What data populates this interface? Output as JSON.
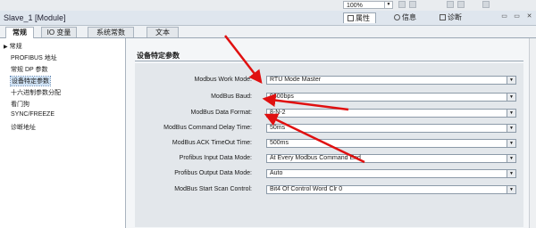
{
  "toolbar": {
    "zoom": "100%"
  },
  "title_bar": {
    "title": "Slave_1 [Module]",
    "inspector_tabs": [
      {
        "label": "属性",
        "icon": "properties-icon"
      },
      {
        "label": "信息",
        "icon": "info-icon"
      },
      {
        "label": "诊断",
        "icon": "diagnostics-icon"
      }
    ]
  },
  "tabs": [
    "常规",
    "IO 变量",
    "系统常数",
    "文本"
  ],
  "nav": {
    "items": [
      "常规",
      "PROFIBUS 地址",
      "常规 DP 参数",
      "设备特定参数",
      "十六进制参数分配",
      "看门狗",
      "SYNC/FREEZE",
      "诊断地址"
    ],
    "selected_index": 3
  },
  "section_title": "设备特定参数",
  "params": [
    {
      "label": "Modbus Work Mode:",
      "value": "RTU Mode Master"
    },
    {
      "label": "ModBus Baud:",
      "value": "9600bps"
    },
    {
      "label": "ModBus Data Format:",
      "value": "8-N-2"
    },
    {
      "label": "ModBus Command Delay Time:",
      "value": "50ms"
    },
    {
      "label": "ModBus ACK TimeOut Time:",
      "value": "500ms"
    },
    {
      "label": "Profibus Input Data Mode:",
      "value": "At Every Modbus Command End"
    },
    {
      "label": "Profibus Output Data Mode:",
      "value": "Auto"
    },
    {
      "label": "ModBus Start Scan Control:",
      "value": "Bit4 Of Control Word Clr 0"
    }
  ],
  "colors": {
    "annotation_arrow": "#e01010",
    "selected_nav": "#cfe2f5"
  }
}
